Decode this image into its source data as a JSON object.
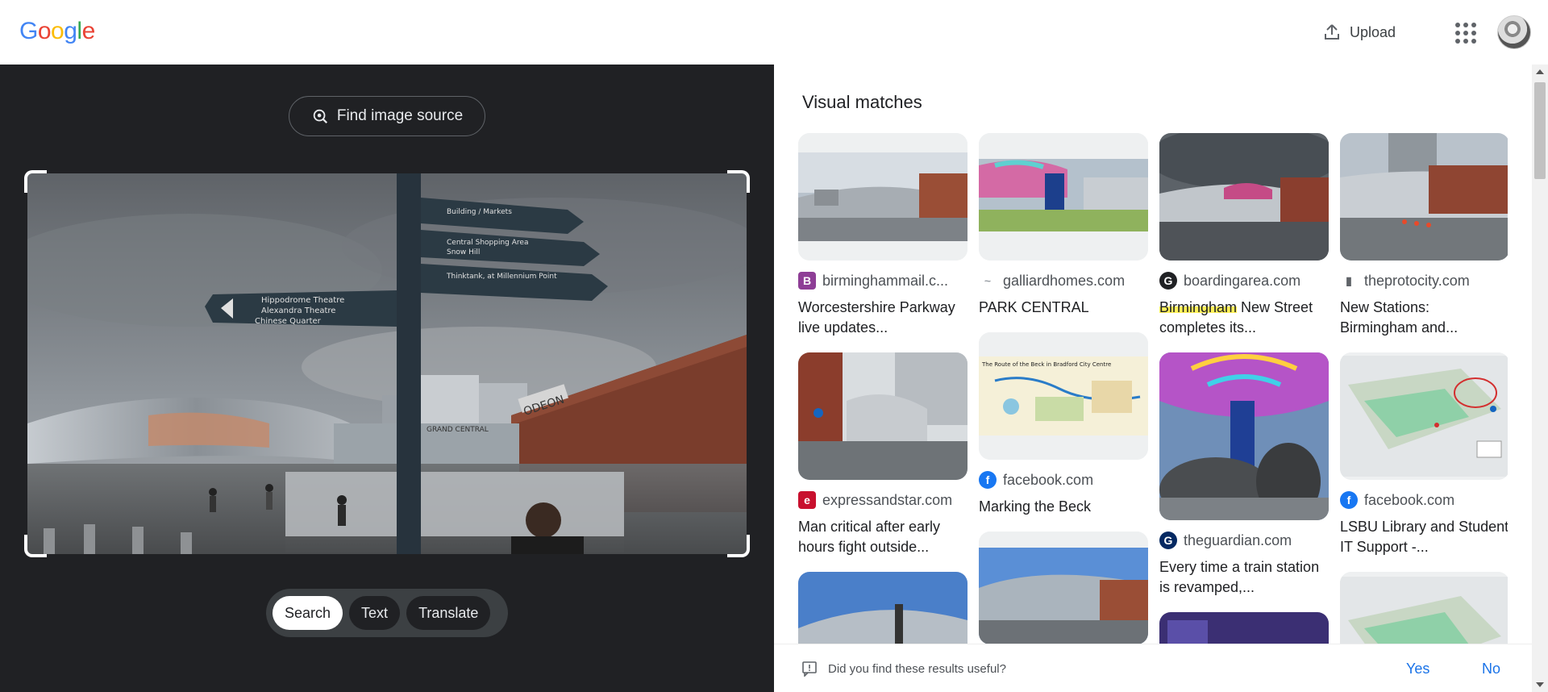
{
  "header": {
    "logo_letters": [
      "G",
      "o",
      "o",
      "g",
      "l",
      "e"
    ],
    "logo_colors": [
      "#4285f4",
      "#ea4335",
      "#fbbc05",
      "#4285f4",
      "#34a853",
      "#ea4335"
    ],
    "upload_label": "Upload"
  },
  "left_panel": {
    "find_source_label": "Find image source",
    "sign_texts": [
      "Hippodrome Theatre",
      "Alexandra Theatre",
      "Chinese Quarter",
      "Central Shopping Area",
      "Snow Hill",
      "ODEON",
      "GRAND CENTRAL"
    ],
    "modes": [
      {
        "label": "Search",
        "active": true
      },
      {
        "label": "Text",
        "active": false
      },
      {
        "label": "Translate",
        "active": false
      }
    ]
  },
  "right_panel": {
    "section_title": "Visual matches",
    "results": [
      {
        "source": "birminghammail.c...",
        "favicon": "B",
        "favicon_color": "#8e3e96",
        "title": "Worcestershire Parkway live updates..."
      },
      {
        "source": "galliardhomes.com",
        "favicon": "~",
        "favicon_color": "#9aa0a6",
        "title": "PARK CENTRAL"
      },
      {
        "source": "boardingarea.com",
        "favicon": "G",
        "favicon_color": "#202124",
        "title_highlight": "Birmingham",
        "title_rest": " New Street completes its..."
      },
      {
        "source": "theprotocity.com",
        "favicon": "▮",
        "favicon_color": "#5f6368",
        "title": "New Stations: Birmingham and..."
      },
      {
        "source": "expressandstar.com",
        "favicon": "e",
        "favicon_color": "#c8102e",
        "title": "Man critical after early hours fight outside..."
      },
      {
        "source": "facebook.com",
        "favicon": "f",
        "favicon_color": "#1877f2",
        "title": "Marking the Beck",
        "map_title": "The Route of the Beck in Bradford City Centre"
      },
      {
        "source": "theguardian.com",
        "favicon": "G",
        "favicon_color": "#052962",
        "title": "Every time a train station is revamped,..."
      },
      {
        "source": "facebook.com",
        "favicon": "f",
        "favicon_color": "#1877f2",
        "title": "LSBU Library and Student IT Support -..."
      }
    ]
  },
  "footer": {
    "question": "Did you find these results useful?",
    "yes": "Yes",
    "no": "No"
  },
  "colors": {
    "dark_bg": "#202124",
    "accent_blue": "#1a73e8",
    "highlight": "#fff15a"
  }
}
